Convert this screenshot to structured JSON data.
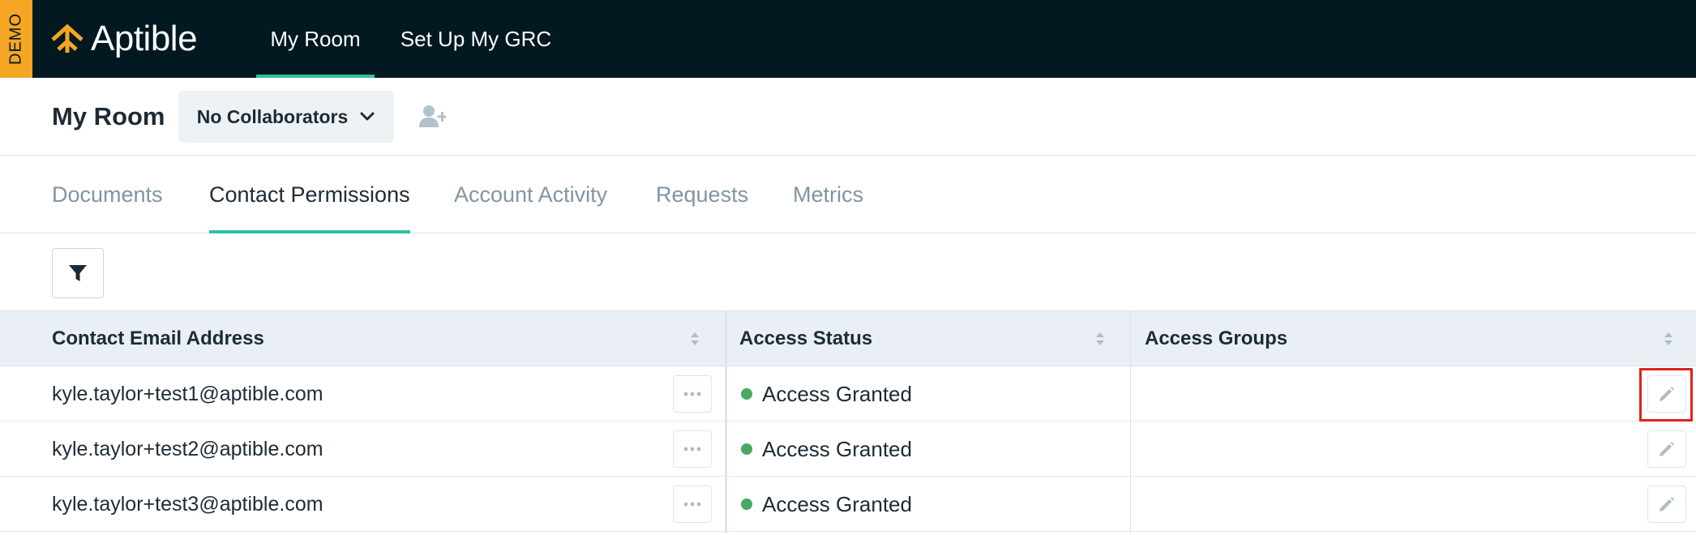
{
  "topbar": {
    "demo_label": "DEMO",
    "brand": "Aptible",
    "nav": [
      {
        "label": "My Room",
        "active": true
      },
      {
        "label": "Set Up My GRC",
        "active": false
      }
    ]
  },
  "room": {
    "title": "My Room",
    "collaborators_label": "No Collaborators",
    "add_user_icon": "user-plus-icon"
  },
  "tabs": [
    {
      "label": "Documents",
      "active": false
    },
    {
      "label": "Contact Permissions",
      "active": true
    },
    {
      "label": "Account Activity",
      "active": false
    },
    {
      "label": "Requests",
      "active": false
    },
    {
      "label": "Metrics",
      "active": false
    }
  ],
  "toolbar": {
    "filter_icon": "filter-icon"
  },
  "table": {
    "columns": [
      "Contact Email Address",
      "Access Status",
      "Access Groups"
    ],
    "rows": [
      {
        "email": "kyle.taylor+test1@aptible.com",
        "status": "Access Granted",
        "groups": ""
      },
      {
        "email": "kyle.taylor+test2@aptible.com",
        "status": "Access Granted",
        "groups": ""
      },
      {
        "email": "kyle.taylor+test3@aptible.com",
        "status": "Access Granted",
        "groups": ""
      }
    ]
  },
  "colors": {
    "nav_bg": "#021921",
    "demo_badge": "#f5a623",
    "accent": "#2fc1a1",
    "status_granted": "#4aa866",
    "highlight": "#e0221c"
  }
}
